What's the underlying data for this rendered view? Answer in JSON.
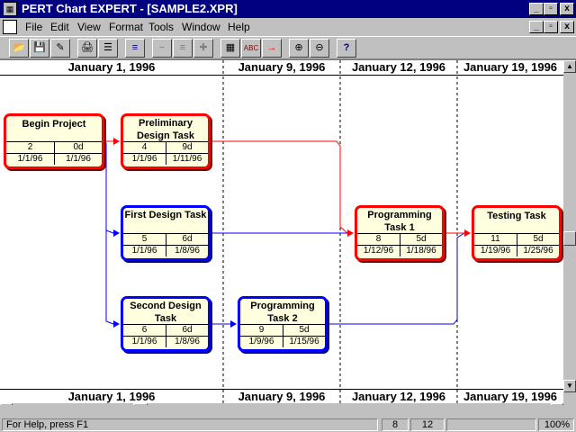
{
  "window": {
    "title": "PERT Chart EXPERT - [SAMPLE2.XPR]",
    "controls": [
      "_",
      "▫",
      "x"
    ]
  },
  "menu": {
    "items": [
      "File",
      "Edit",
      "View",
      "Format",
      "Tools",
      "Window",
      "Help"
    ]
  },
  "toolbar": {
    "buttons": [
      {
        "name": "open-folder-icon",
        "glyph": "📂"
      },
      {
        "name": "save-icon",
        "glyph": "💾"
      },
      {
        "name": "edit-icon",
        "glyph": "✎"
      },
      {
        "name": "print-icon",
        "glyph": "🖨"
      },
      {
        "name": "print-preview-icon",
        "glyph": "☰"
      },
      {
        "name": "list-icon",
        "glyph": "≡"
      },
      {
        "name": "remove-icon",
        "glyph": "−"
      },
      {
        "name": "remove-link-icon",
        "glyph": "≡"
      },
      {
        "name": "add-icon",
        "glyph": "✚"
      },
      {
        "name": "calculator-icon",
        "glyph": "▦"
      },
      {
        "name": "spellcheck-icon",
        "glyph": "ABC"
      },
      {
        "name": "arrow-right-icon",
        "glyph": "→"
      },
      {
        "name": "zoom-in-icon",
        "glyph": "⊕"
      },
      {
        "name": "zoom-out-icon",
        "glyph": "⊖"
      },
      {
        "name": "help-icon",
        "glyph": "?"
      }
    ]
  },
  "timescale": {
    "dates": [
      "January 1, 1996",
      "January 9, 1996",
      "January 12, 1996",
      "January 19, 1996"
    ]
  },
  "tasks": [
    {
      "name": "Begin Project",
      "id": "2",
      "duration": "0d",
      "start": "1/1/96",
      "finish": "1/1/96",
      "critical": true
    },
    {
      "name": "Preliminary Design Task",
      "id": "4",
      "duration": "9d",
      "start": "1/1/96",
      "finish": "1/11/96",
      "critical": true
    },
    {
      "name": "First Design Task",
      "id": "5",
      "duration": "6d",
      "start": "1/1/96",
      "finish": "1/8/96",
      "critical": false
    },
    {
      "name": "Second Design Task",
      "id": "6",
      "duration": "6d",
      "start": "1/1/96",
      "finish": "1/8/96",
      "critical": false
    },
    {
      "name": "Programming Task 2",
      "id": "9",
      "duration": "5d",
      "start": "1/9/96",
      "finish": "1/15/96",
      "critical": false
    },
    {
      "name": "Programming Task 1",
      "id": "8",
      "duration": "5d",
      "start": "1/12/96",
      "finish": "1/18/96",
      "critical": true
    },
    {
      "name": "Testing Task",
      "id": "11",
      "duration": "5d",
      "start": "1/19/96",
      "finish": "1/25/96",
      "critical": true
    }
  ],
  "colors": {
    "critical": "#ff0000",
    "noncritical": "#0000ff",
    "titlebar": "#000080",
    "node_fill": "#ffffe0"
  },
  "status": {
    "help": "For Help, press F1",
    "field1": "8",
    "field2": "12",
    "zoom": "100%"
  }
}
